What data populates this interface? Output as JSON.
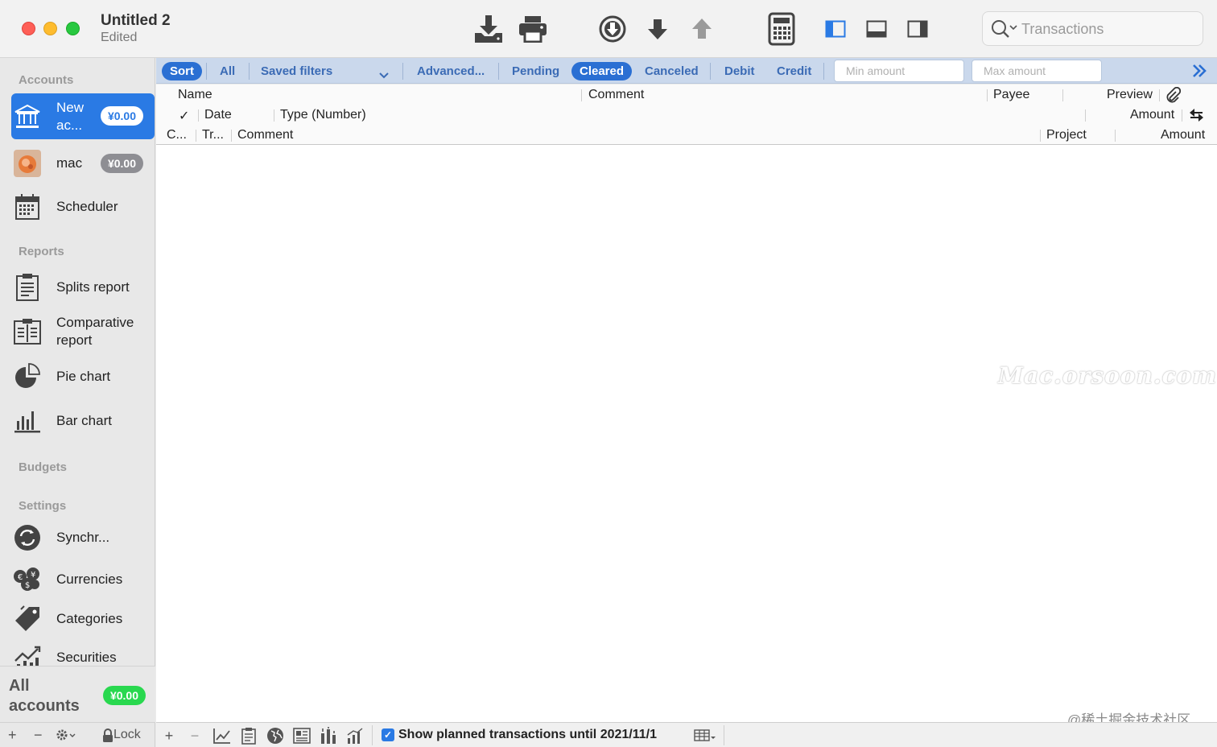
{
  "window": {
    "title": "Untitled 2",
    "subtitle": "Edited"
  },
  "toolbar": {
    "buttons": [
      "import-icon",
      "print-icon",
      "download-circle-icon",
      "arrow-down-icon",
      "arrow-up-icon",
      "calculator-icon",
      "layout-left-icon",
      "layout-bottom-icon",
      "layout-right-icon"
    ],
    "search_placeholder": "Transactions"
  },
  "sidebar": {
    "accounts_label": "Accounts",
    "accounts": [
      {
        "name": "New ac...",
        "balance": "¥0.00"
      },
      {
        "name": "mac",
        "balance": "¥0.00"
      }
    ],
    "scheduler": "Scheduler",
    "reports_label": "Reports",
    "reports": [
      "Splits report",
      "Comparative report",
      "Pie chart",
      "Bar chart"
    ],
    "budgets_label": "Budgets",
    "settings_label": "Settings",
    "settings": [
      "Synchr...",
      "Currencies",
      "Categories",
      "Securities"
    ],
    "all_accounts": {
      "label": "All accounts",
      "balance": "¥0.00"
    },
    "bottom": {
      "add": "+",
      "remove": "−",
      "lock": "Lock"
    }
  },
  "filterbar": {
    "sort": "Sort",
    "all": "All",
    "saved_filters": "Saved filters",
    "advanced": "Advanced...",
    "pending": "Pending",
    "cleared": "Cleared",
    "canceled": "Canceled",
    "debit": "Debit",
    "credit": "Credit",
    "min_amount_placeholder": "Min amount",
    "max_amount_placeholder": "Max amount"
  },
  "columns": {
    "row1": {
      "name": "Name",
      "comment": "Comment",
      "payee": "Payee",
      "preview": "Preview"
    },
    "row2": {
      "check": "✓",
      "date": "Date",
      "type": "Type (Number)",
      "amount": "Amount"
    },
    "row3": {
      "c": "C...",
      "tr": "Tr...",
      "comment": "Comment",
      "project": "Project",
      "amount": "Amount"
    }
  },
  "bottombar": {
    "add": "+",
    "remove": "−",
    "planned_label": "Show planned transactions until 2021/11/1",
    "planned_checked": true
  },
  "watermark": "Mac.orsoon.com",
  "credit": "@稀土掘金技术社区"
}
